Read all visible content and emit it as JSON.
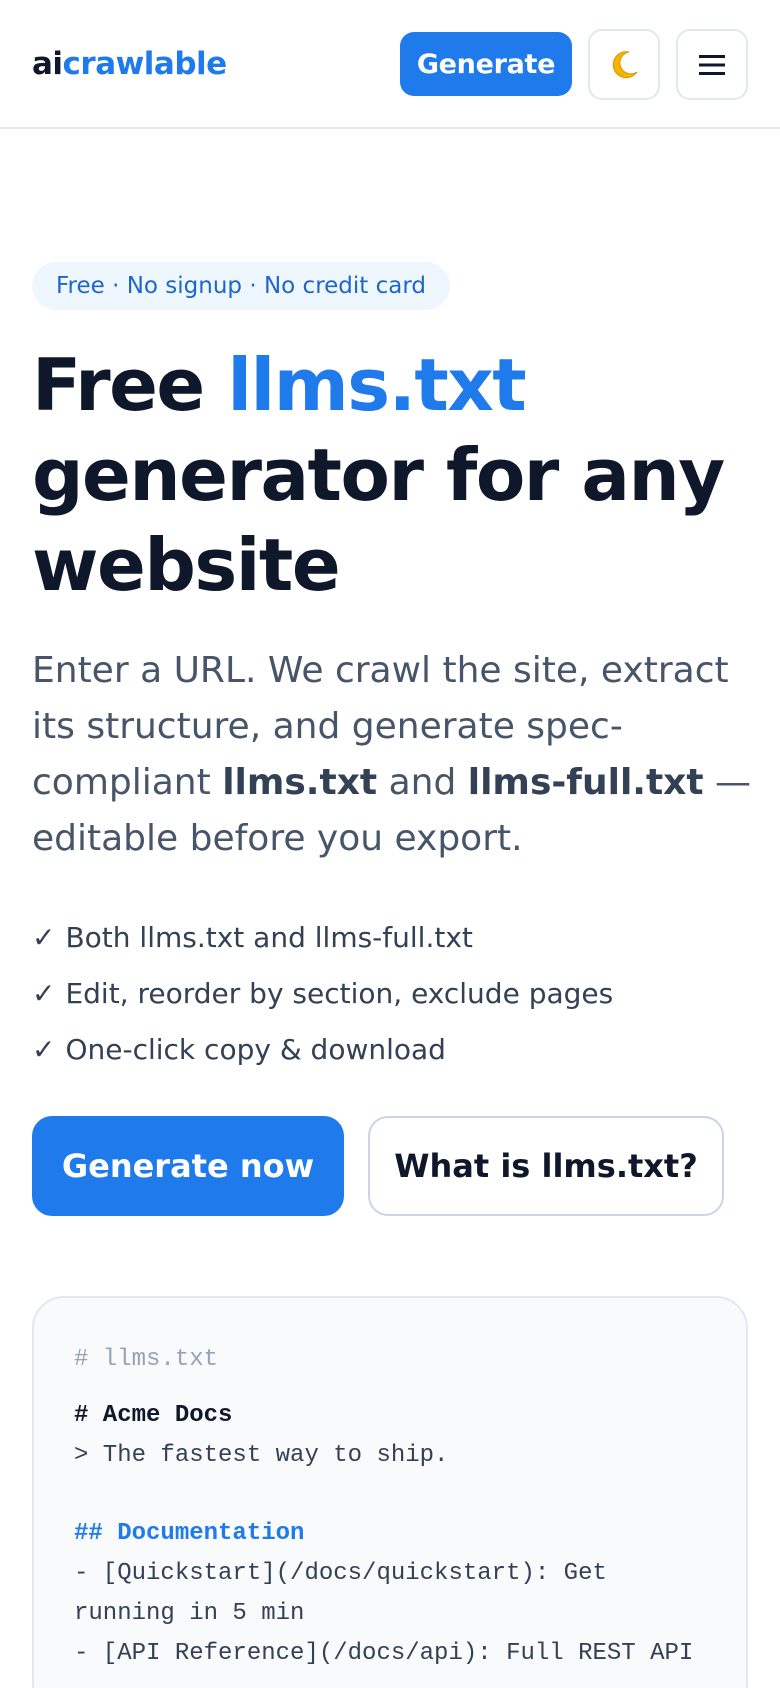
{
  "header": {
    "logo_prefix": "ai",
    "logo_suffix": "crawlable",
    "generate_label": "Generate",
    "theme_toggle_icon": "moon-icon",
    "menu_icon": "hamburger-icon"
  },
  "hero": {
    "badge": "Free · No signup · No credit card",
    "title_part1": "Free ",
    "title_accent": "llms.txt",
    "title_part2": "generator for any website",
    "lead_part1": "Enter a URL. We crawl the site, extract its structure, and generate spec-compliant ",
    "lead_bold1": "llms.txt",
    "lead_part2": " and ",
    "lead_bold2": "llms-full.txt",
    "lead_part3": " — editable before you export.",
    "features": [
      "Both llms.txt and llms-full.txt",
      "Edit, reorder by section, exclude pages",
      "One-click copy & download"
    ],
    "check_mark": "✓",
    "primary_cta": "Generate now",
    "secondary_cta": "What is llms.txt?"
  },
  "code_preview": {
    "comment": "# llms.txt",
    "title": "# Acme Docs",
    "tagline": "> The fastest way to ship.",
    "section": "## Documentation",
    "items": [
      "- [Quickstart](/docs/quickstart): Get running in 5 min",
      "- [API Reference](/docs/api): Full REST API"
    ]
  },
  "colors": {
    "accent": "#1f7aec",
    "text": "#0f172a",
    "muted": "#475569",
    "badge_bg": "#eef6ff"
  }
}
